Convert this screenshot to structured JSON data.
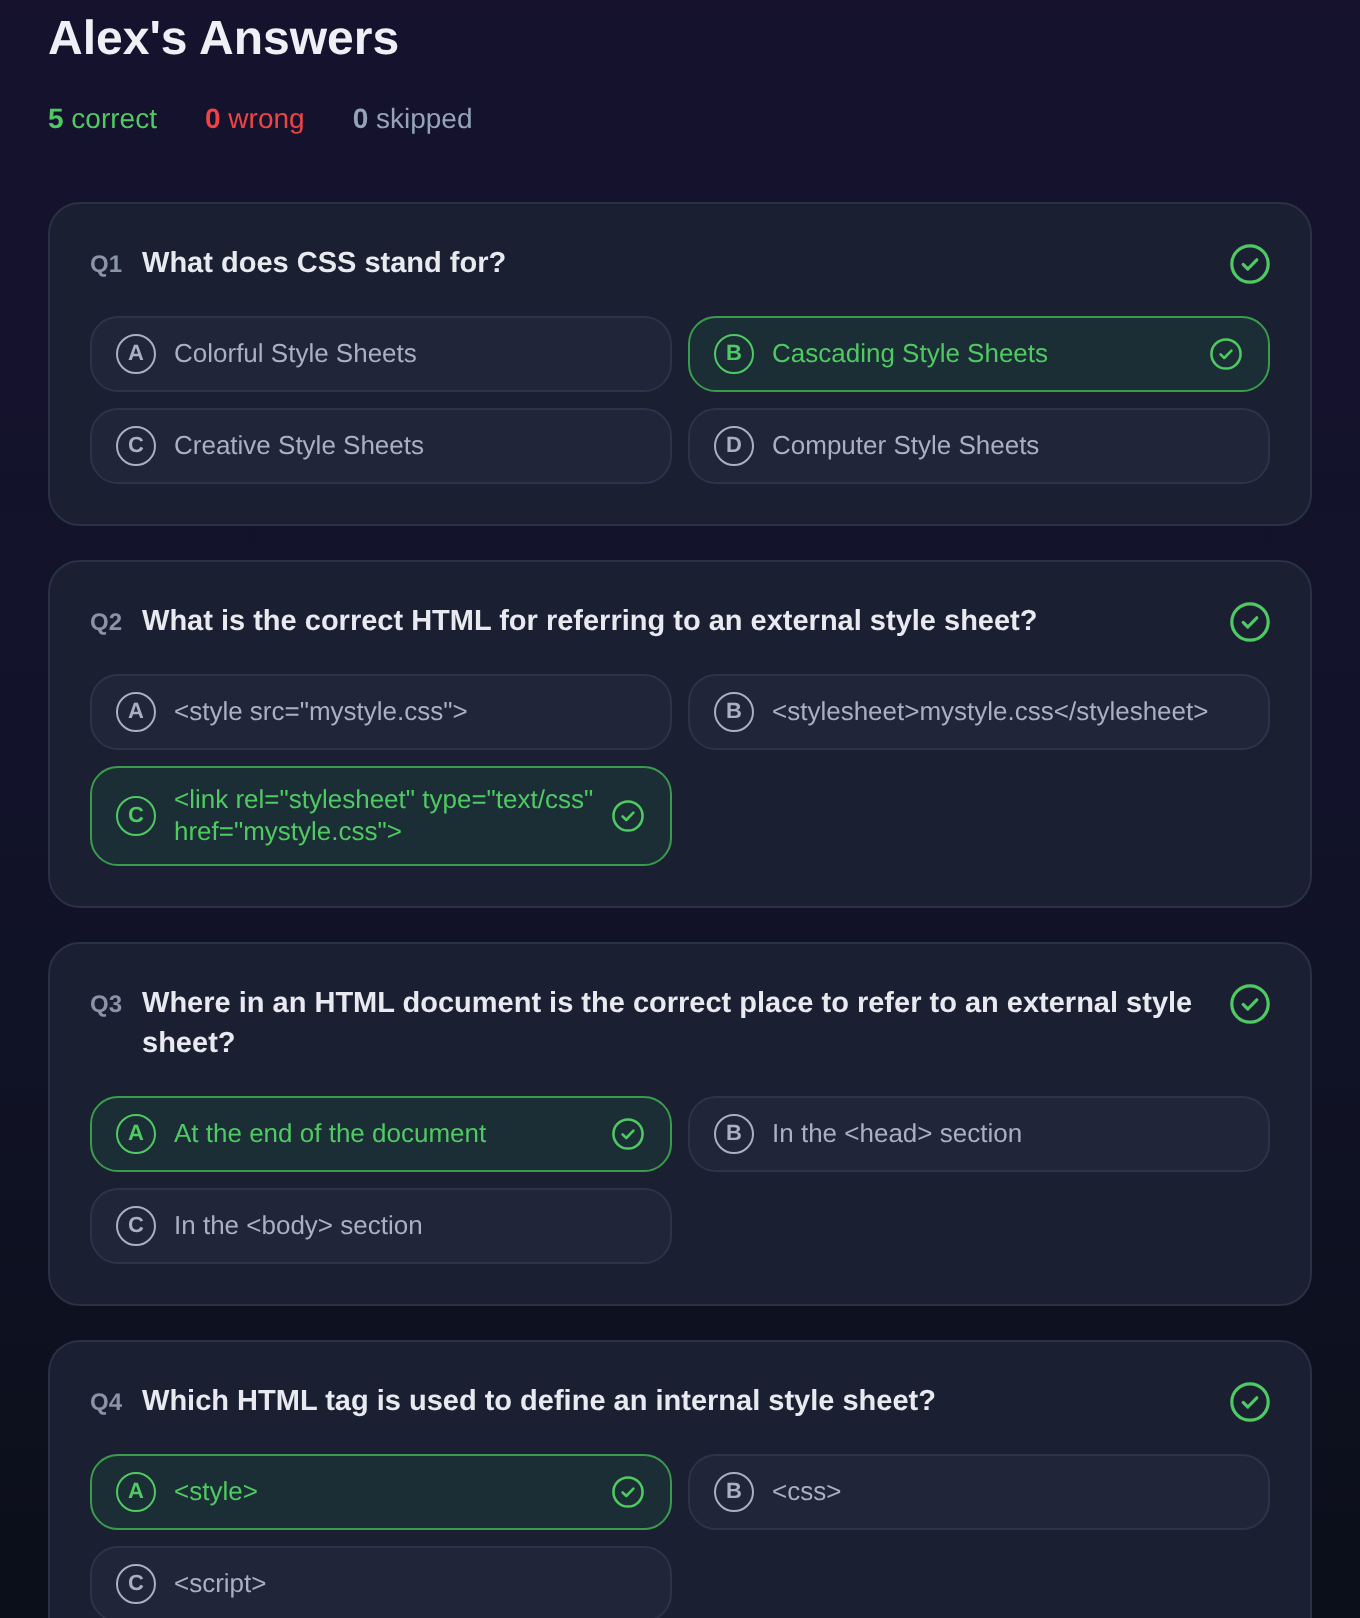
{
  "page": {
    "title": "Alex's Answers"
  },
  "summary": [
    {
      "kind": "correct",
      "count": "5",
      "label": "correct"
    },
    {
      "kind": "wrong",
      "count": "0",
      "label": "wrong"
    },
    {
      "kind": "skipped",
      "count": "0",
      "label": "skipped"
    }
  ],
  "questions": [
    {
      "number": "Q1",
      "text": "What does CSS stand for?",
      "correct": true,
      "options": [
        {
          "letter": "A",
          "text": "Colorful Style Sheets",
          "selected": false
        },
        {
          "letter": "B",
          "text": "Cascading Style Sheets",
          "selected": true
        },
        {
          "letter": "C",
          "text": "Creative Style Sheets",
          "selected": false
        },
        {
          "letter": "D",
          "text": "Computer Style Sheets",
          "selected": false
        }
      ]
    },
    {
      "number": "Q2",
      "text": "What is the correct HTML for referring to an external style sheet?",
      "correct": true,
      "options": [
        {
          "letter": "A",
          "text": "<style src=\"mystyle.css\">",
          "selected": false
        },
        {
          "letter": "B",
          "text": "<stylesheet>mystyle.css</stylesheet>",
          "selected": false
        },
        {
          "letter": "C",
          "text": "<link rel=\"stylesheet\" type=\"text/css\" href=\"mystyle.css\">",
          "selected": true
        }
      ]
    },
    {
      "number": "Q3",
      "text": "Where in an HTML document is the correct place to refer to an external style sheet?",
      "correct": true,
      "options": [
        {
          "letter": "A",
          "text": "At the end of the document",
          "selected": true
        },
        {
          "letter": "B",
          "text": "In the <head> section",
          "selected": false
        },
        {
          "letter": "C",
          "text": "In the <body> section",
          "selected": false
        }
      ]
    },
    {
      "number": "Q4",
      "text": "Which HTML tag is used to define an internal style sheet?",
      "correct": true,
      "options": [
        {
          "letter": "A",
          "text": "<style>",
          "selected": true
        },
        {
          "letter": "B",
          "text": "<css>",
          "selected": false
        },
        {
          "letter": "C",
          "text": "<script>",
          "selected": false
        }
      ]
    }
  ]
}
